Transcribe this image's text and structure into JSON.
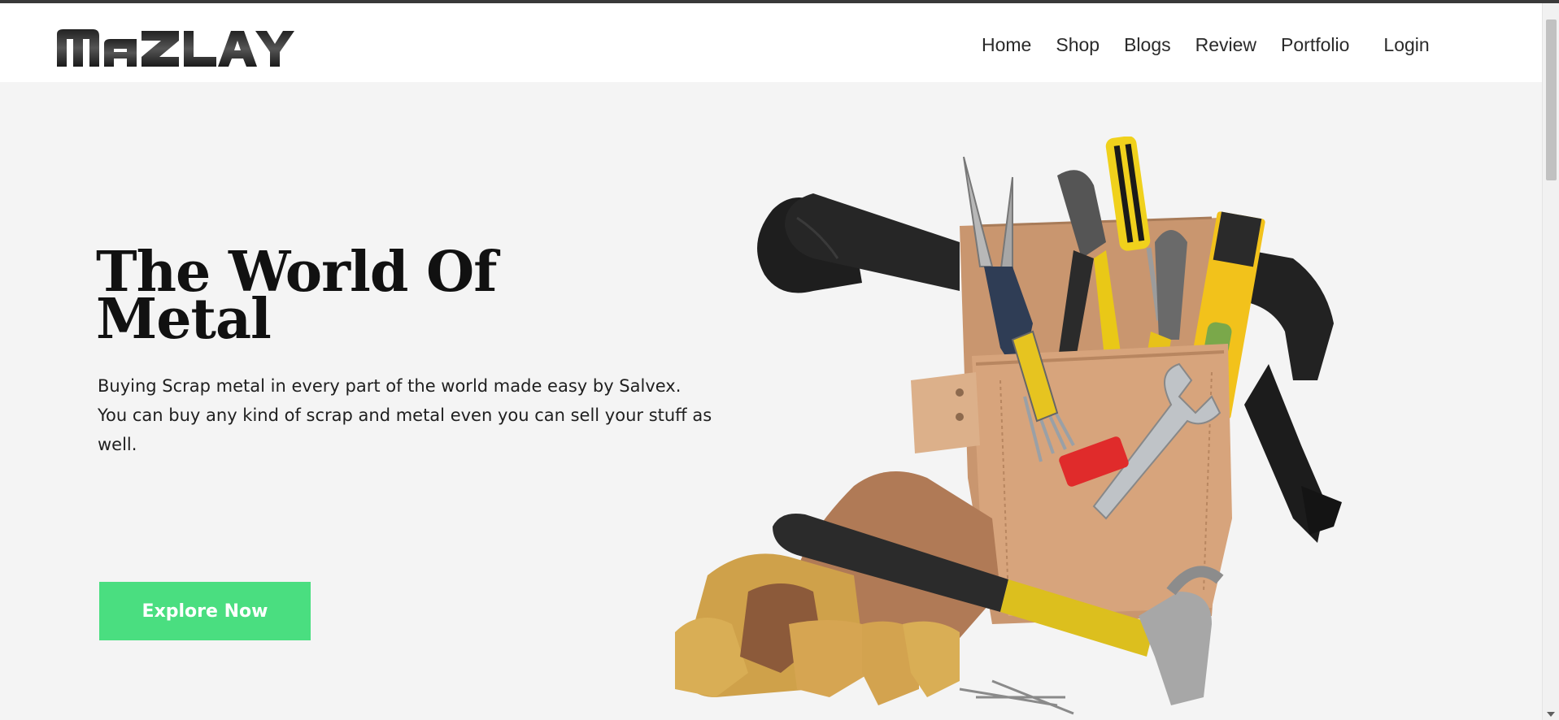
{
  "brand": {
    "logo_text": "MAZLAY"
  },
  "nav": {
    "items": [
      {
        "label": "Home"
      },
      {
        "label": "Shop"
      },
      {
        "label": "Blogs"
      },
      {
        "label": "Review"
      },
      {
        "label": "Portfolio"
      }
    ],
    "login_label": "Login"
  },
  "hero": {
    "title_line1": "The World Of",
    "title_line2": "Metal",
    "description": "Buying Scrap metal in every part of the world made easy by Salvex. You can buy any kind of scrap and metal even you can sell your stuff as well.",
    "cta_label": "Explore Now"
  },
  "colors": {
    "cta": "#4ade80",
    "header_bg": "#ffffff",
    "page_bg": "#f4f4f4"
  }
}
